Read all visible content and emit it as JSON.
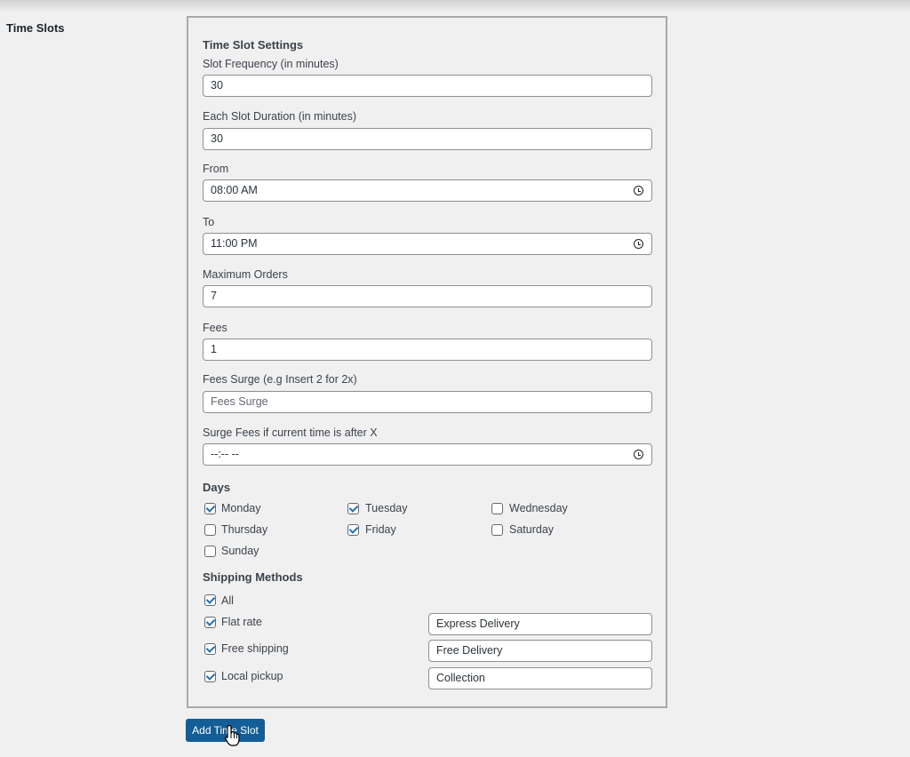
{
  "section": {
    "label": "Time Slots"
  },
  "settings": {
    "heading": "Time Slot Settings",
    "slot_frequency": {
      "label": "Slot Frequency (in minutes)",
      "value": "30"
    },
    "slot_duration": {
      "label": "Each Slot Duration (in minutes)",
      "value": "30"
    },
    "from": {
      "label": "From",
      "value": "08:00 AM"
    },
    "to": {
      "label": "To",
      "value": "11:00 PM"
    },
    "max_orders": {
      "label": "Maximum Orders",
      "value": "7"
    },
    "fees": {
      "label": "Fees",
      "value": "1"
    },
    "fees_surge": {
      "label": "Fees Surge (e.g Insert 2 for 2x)",
      "value": "",
      "placeholder": "Fees Surge"
    },
    "surge_after": {
      "label": "Surge Fees if current time is after X",
      "value": "--:-- --"
    }
  },
  "days": {
    "heading": "Days",
    "items": [
      {
        "label": "Monday",
        "checked": true
      },
      {
        "label": "Tuesday",
        "checked": true
      },
      {
        "label": "Wednesday",
        "checked": false
      },
      {
        "label": "Thursday",
        "checked": false
      },
      {
        "label": "Friday",
        "checked": true
      },
      {
        "label": "Saturday",
        "checked": false
      },
      {
        "label": "Sunday",
        "checked": false
      }
    ]
  },
  "shipping": {
    "heading": "Shipping Methods",
    "all": {
      "label": "All",
      "checked": true
    },
    "methods": [
      {
        "label": "Flat rate",
        "checked": true,
        "display_name": "Express Delivery"
      },
      {
        "label": "Free shipping",
        "checked": true,
        "display_name": "Free Delivery"
      },
      {
        "label": "Local pickup",
        "checked": true,
        "display_name": "Collection"
      }
    ]
  },
  "actions": {
    "add_button": "Add Time Slot"
  },
  "colors": {
    "primary": "#135e96",
    "checkmark": "#2271b1",
    "background": "#f0f0f1"
  }
}
